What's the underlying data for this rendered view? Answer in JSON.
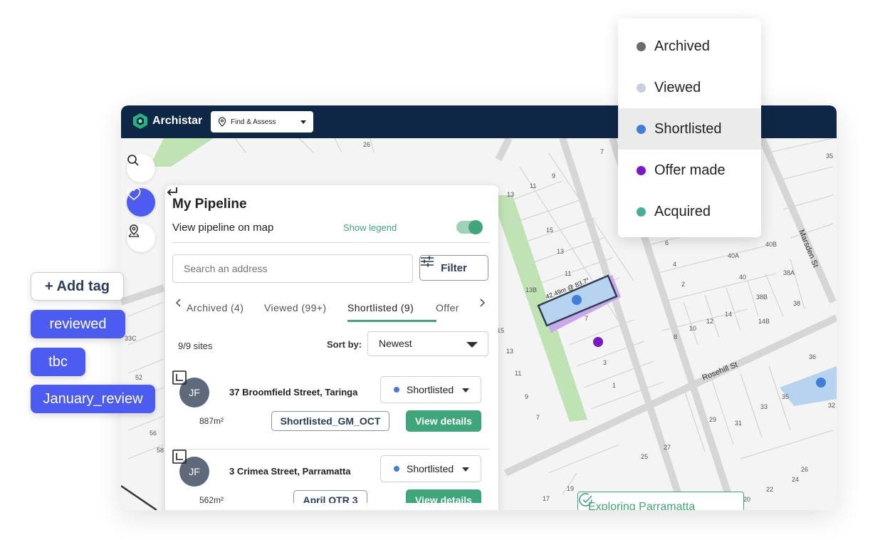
{
  "app": {
    "brand": "Archistar",
    "module_select": "Find & Assess"
  },
  "map_labels": [
    "26",
    "7",
    "9",
    "11",
    "13",
    "15",
    "13",
    "11",
    "13B",
    "7",
    "15",
    "13",
    "11",
    "9",
    "7",
    "3",
    "1",
    "6",
    "4",
    "2",
    "8",
    "10",
    "12",
    "14",
    "40A",
    "40B",
    "40",
    "38A",
    "38B",
    "38",
    "14B",
    "36",
    "35",
    "32",
    "33",
    "31",
    "29",
    "27",
    "25",
    "24",
    "26",
    "22",
    "20",
    "19",
    "17",
    "33C",
    "52",
    "56",
    "58",
    "101",
    "3",
    "35"
  ],
  "streets": {
    "rosehill": "Rosehill St",
    "marsden": "Marsden St",
    "measurement": "42.49m @ 83.7°"
  },
  "panel": {
    "title": "My Pipeline",
    "subtitle": "View pipeline on map",
    "legend_link": "Show legend",
    "toggle_on": true,
    "search_placeholder": "Search an address",
    "filter_label": "Filter",
    "tabs": [
      {
        "label": "Archived (4)"
      },
      {
        "label": "Viewed (99+)"
      },
      {
        "label": "Shortlisted (9)"
      },
      {
        "label": "Offer"
      }
    ],
    "count": "9/9 sites",
    "sort_label": "Sort by:",
    "sort_value": "Newest",
    "cards": [
      {
        "initials": "JF",
        "address": "37 Broomfield Street, Taringa",
        "status": "Shortlisted",
        "area": "887m²",
        "tag": "Shortlisted_GM_OCT",
        "action": "View details"
      },
      {
        "initials": "JF",
        "address": "3 Crimea Street, Parramatta",
        "status": "Shortlisted",
        "area": "562m²",
        "tag": "April OTR 3",
        "action": "View details"
      }
    ]
  },
  "exploring": "Exploring Parramatta",
  "legend": {
    "items": [
      {
        "label": "Archived",
        "color": "#6b6b6b"
      },
      {
        "label": "Viewed",
        "color": "#c5d1dc"
      },
      {
        "label": "Shortlisted",
        "color": "#3f7fd8"
      },
      {
        "label": "Offer made",
        "color": "#7a17c9"
      },
      {
        "label": "Acquired",
        "color": "#49ad9a"
      }
    ],
    "selected": "Shortlisted"
  },
  "tags": {
    "add": "+ Add tag",
    "items": [
      "reviewed",
      "tbc",
      "January_review"
    ]
  },
  "colors": {
    "navy": "#0f2746",
    "accent": "#3fa57a",
    "tag_blue": "#4d5cf0"
  }
}
